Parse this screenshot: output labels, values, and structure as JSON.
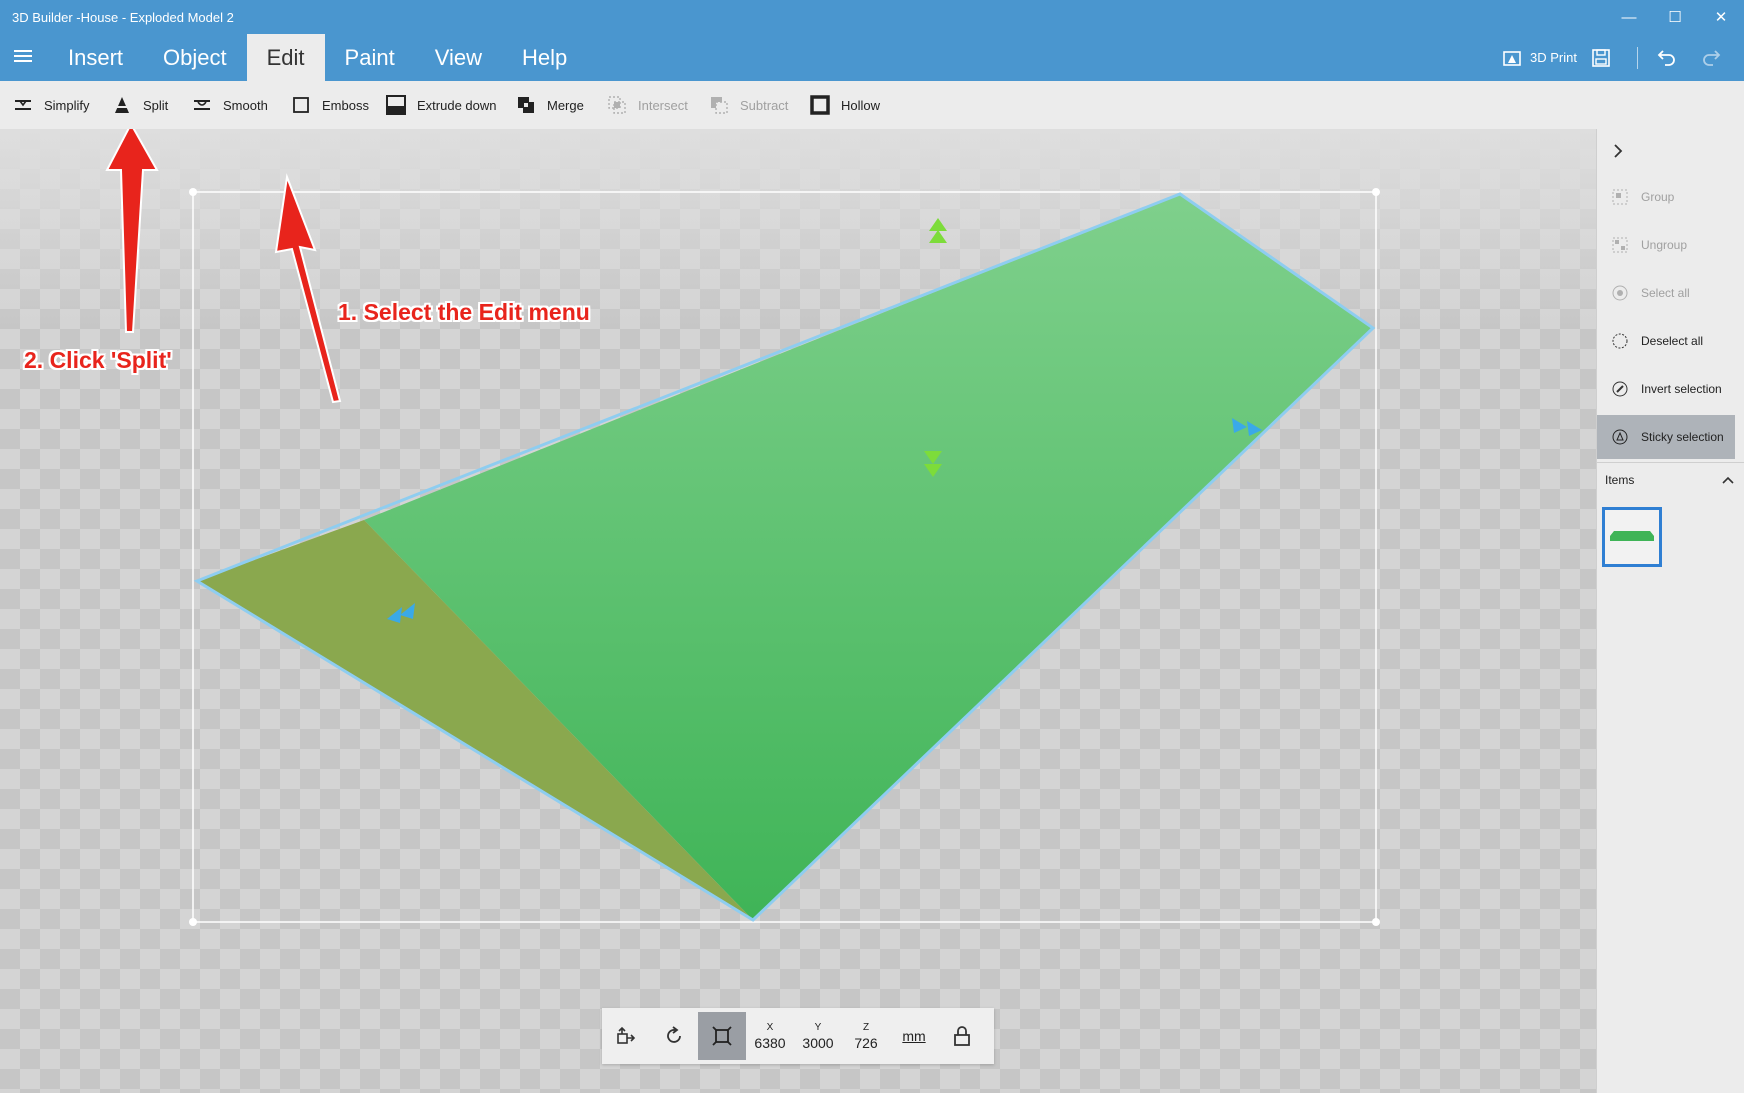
{
  "window": {
    "title": "3D Builder -House - Exploded Model 2",
    "controls": [
      "minimize-icon",
      "maximize-icon",
      "close-icon"
    ]
  },
  "menu": {
    "items": [
      {
        "label": "Insert",
        "active": false
      },
      {
        "label": "Object",
        "active": false
      },
      {
        "label": "Edit",
        "active": true
      },
      {
        "label": "Paint",
        "active": false
      },
      {
        "label": "View",
        "active": false
      },
      {
        "label": "Help",
        "active": false
      }
    ],
    "print_label": "3D Print"
  },
  "toolbar": {
    "simplify": "Simplify",
    "split": "Split",
    "smooth": "Smooth",
    "emboss": "Emboss",
    "extrude_down": "Extrude down",
    "merge": "Merge",
    "intersect": "Intersect",
    "subtract": "Subtract",
    "hollow": "Hollow"
  },
  "annotations": {
    "step1": "1. Select the Edit menu",
    "step2": "2. Click 'Split'"
  },
  "side_panel": {
    "group": "Group",
    "ungroup": "Ungroup",
    "select_all": "Select all",
    "deselect_all": "Deselect all",
    "invert_selection": "Invert selection",
    "sticky_selection": "Sticky selection",
    "items_label": "Items"
  },
  "coordinates": {
    "x_label": "X",
    "x": "6380",
    "y_label": "Y",
    "y": "3000",
    "z_label": "Z",
    "z": "726",
    "unit": "mm"
  },
  "colors": {
    "titlebar": "#4a96cf",
    "model_green": "#4cbb62",
    "model_olive": "#8aa84e",
    "annotation_red": "#e8241c",
    "thumb_border": "#2f7fd3"
  }
}
